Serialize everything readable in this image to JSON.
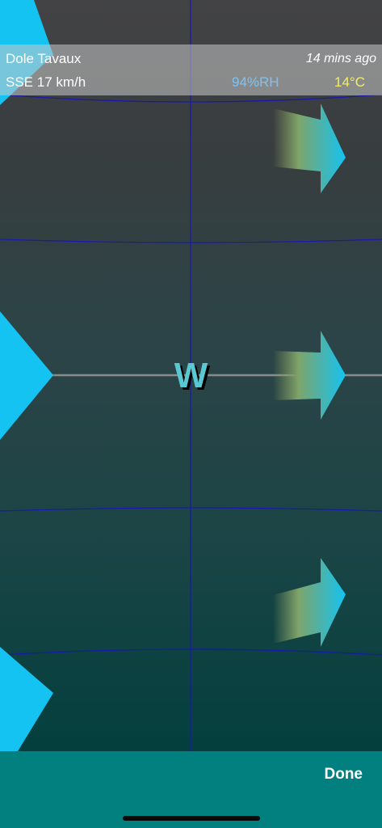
{
  "station": {
    "name": "Dole Tavaux",
    "updated": "14 mins ago",
    "wind": "SSE 17 km/h",
    "humidity": "94%RH",
    "temperature": "14°C"
  },
  "compass": {
    "direction_letter": "W"
  },
  "toolbar": {
    "done_label": "Done"
  },
  "icons": {
    "wind_arrow": "arrow-right-icon",
    "pointer": "triangle-pointer-icon"
  },
  "colors": {
    "arrow_head": "#14c3f2",
    "arrow_tail": "#8c9a5e",
    "grid_line": "#1a1aa8",
    "horizon_line": "#8a8a8a",
    "bottom_bar": "#027f7f",
    "humidity_text": "#7fc2f0",
    "temperature_text": "#f3ec6a"
  }
}
